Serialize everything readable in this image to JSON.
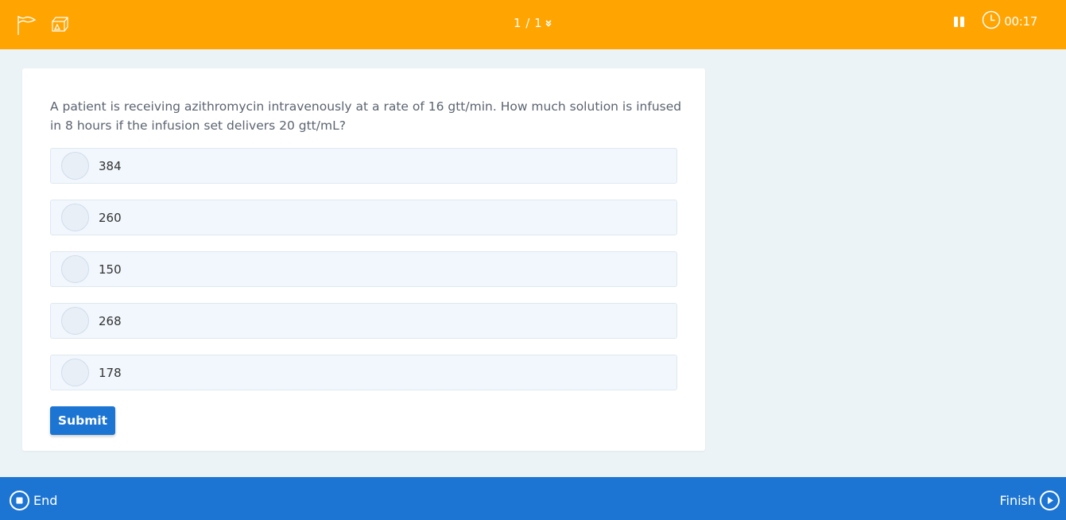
{
  "header": {
    "counter": "1 / 1",
    "timer": "00:17"
  },
  "question": {
    "text": "A patient is receiving azithromycin intravenously at a rate of 16 gtt/min. How much solution is infused\n in 8 hours if the infusion set delivers 20 gtt/mL?",
    "options": [
      {
        "label": "384"
      },
      {
        "label": "260"
      },
      {
        "label": "150"
      },
      {
        "label": "268"
      },
      {
        "label": "178"
      }
    ],
    "submit_label": "Submit"
  },
  "footer": {
    "end_label": "End",
    "finish_label": "Finish"
  },
  "colors": {
    "header_bg": "#ffa400",
    "footer_bg": "#1d75d3",
    "button_bg": "#1d75d3",
    "page_bg": "#ecf3f6"
  }
}
